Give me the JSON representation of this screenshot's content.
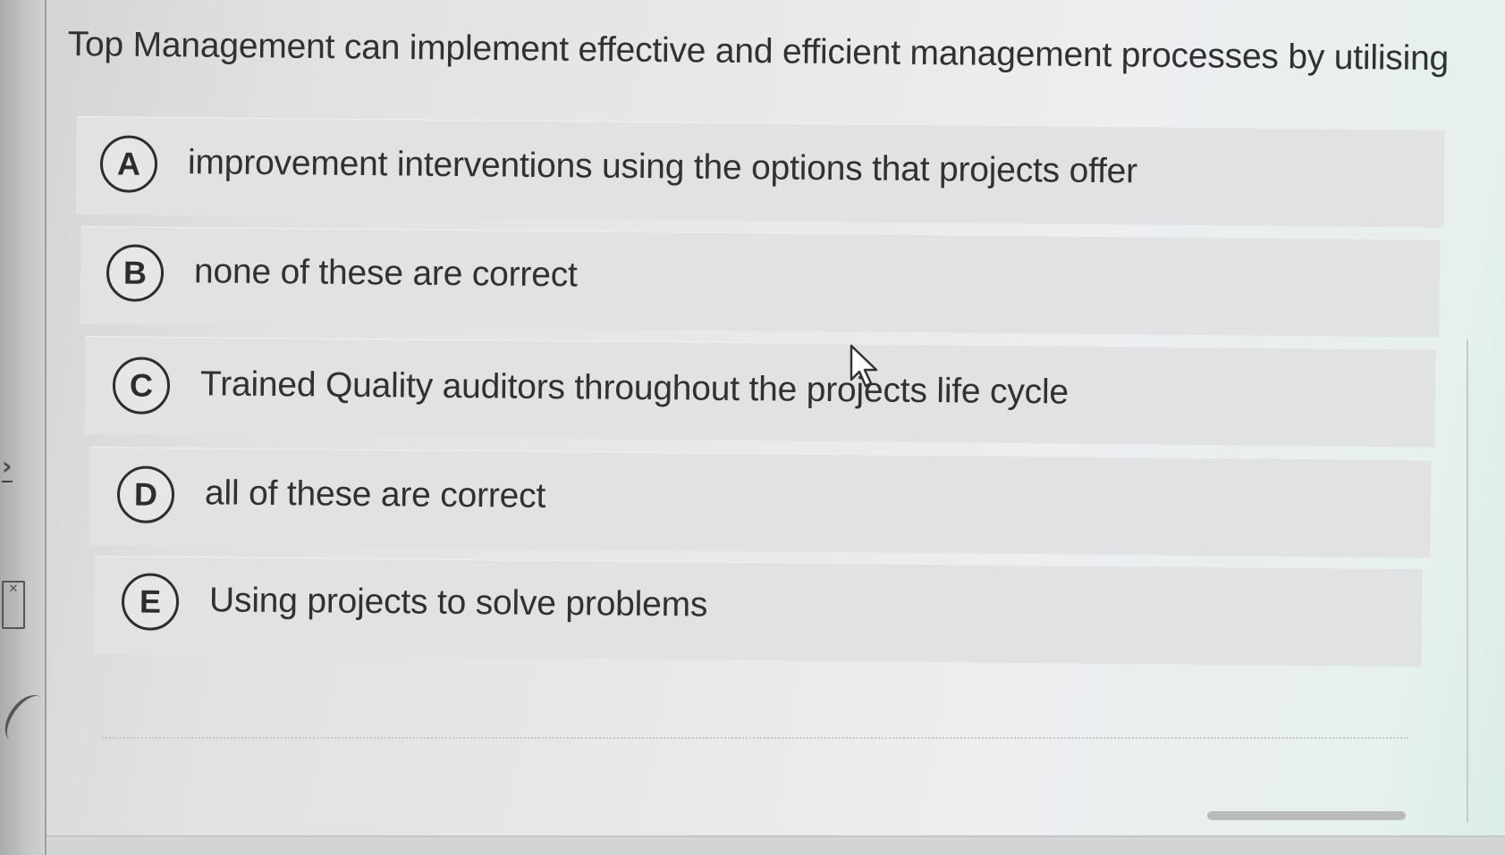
{
  "question": {
    "text": "Top Management can implement effective and efficient management processes by utilising"
  },
  "options": [
    {
      "letter": "A",
      "text": "improvement interventions using the options that projects offer"
    },
    {
      "letter": "B",
      "text": "none of these are correct"
    },
    {
      "letter": "C",
      "text": "Trained Quality auditors throughout the projects life cycle"
    },
    {
      "letter": "D",
      "text": "all of these are correct"
    },
    {
      "letter": "E",
      "text": "Using projects to solve problems"
    }
  ],
  "sidebar": {
    "icons": [
      "chevron-right-icon",
      "excel-icon"
    ]
  },
  "colors": {
    "option_background": "#e0e2e4",
    "text": "#2f3133",
    "badge_border": "#2b2d2f"
  }
}
